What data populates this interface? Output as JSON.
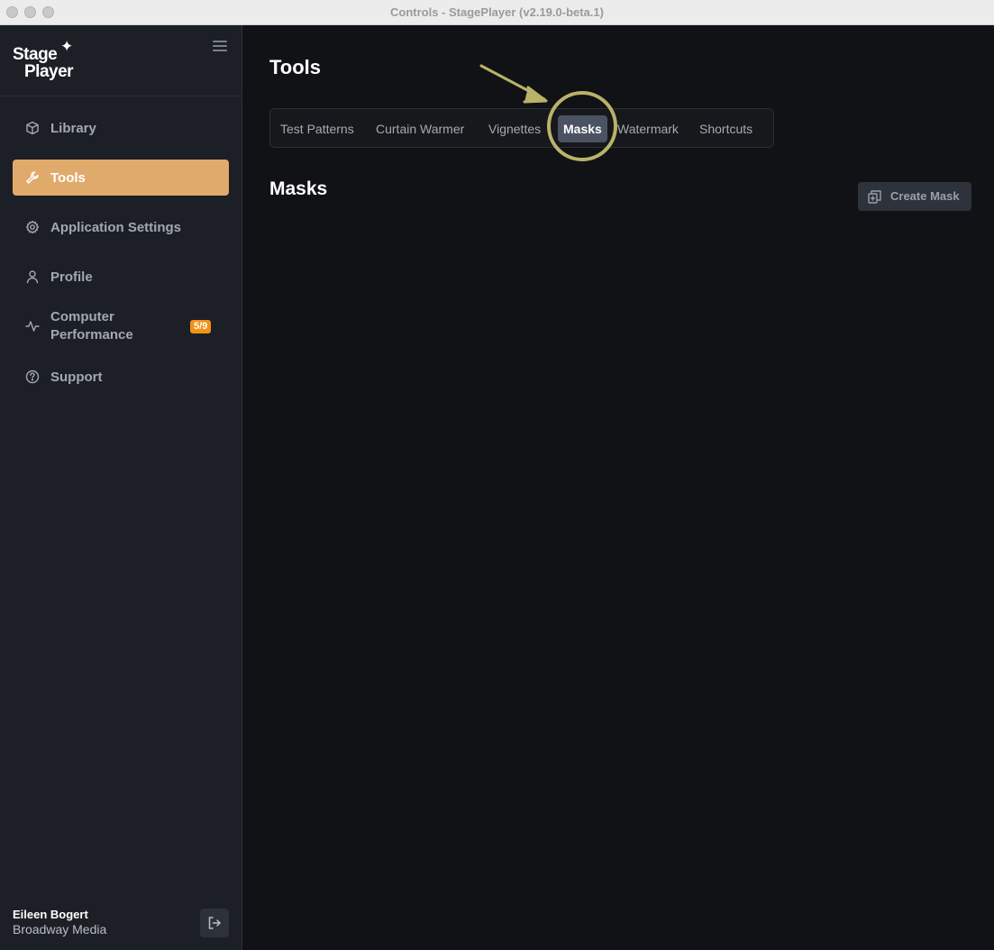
{
  "window": {
    "title": "Controls - StagePlayer (v2.19.0-beta.1)"
  },
  "brand": {
    "line1": "Stage",
    "line2": "Player",
    "spark": "✦"
  },
  "sidebar": {
    "items": [
      {
        "label": "Library",
        "icon": "cube-icon"
      },
      {
        "label": "Tools",
        "icon": "wrench-icon",
        "active": true
      },
      {
        "label": "Application Settings",
        "icon": "gear-icon"
      },
      {
        "label": "Profile",
        "icon": "user-icon"
      },
      {
        "label": "Computer Performance",
        "icon": "activity-icon",
        "badge": "5/9"
      },
      {
        "label": "Support",
        "icon": "help-circle-icon"
      }
    ],
    "user": {
      "name": "Eileen Bogert",
      "org": "Broadway Media"
    }
  },
  "main": {
    "title": "Tools",
    "tabs": [
      {
        "label": "Test Patterns"
      },
      {
        "label": "Curtain Warmer"
      },
      {
        "label": "Vignettes"
      },
      {
        "label": "Masks",
        "active": true
      },
      {
        "label": "Watermark"
      },
      {
        "label": "Shortcuts"
      }
    ],
    "section_title": "Masks",
    "create_button": "Create Mask"
  },
  "colors": {
    "accent": "#e0aa6b",
    "badge": "#f39214",
    "annotation": "#c9c27a",
    "background": "#111215",
    "sidebar": "#1c1f26"
  }
}
